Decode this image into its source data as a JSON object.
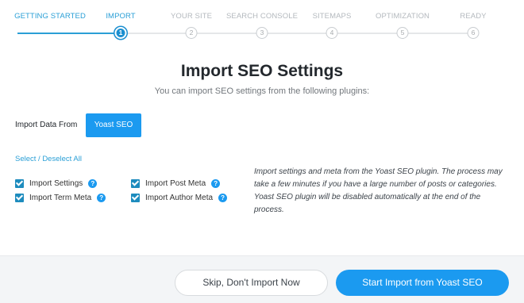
{
  "stepper": {
    "steps": [
      {
        "label": "GETTING STARTED",
        "number": "",
        "state": "done"
      },
      {
        "label": "IMPORT",
        "number": "1",
        "state": "active"
      },
      {
        "label": "YOUR SITE",
        "number": "2",
        "state": "pending"
      },
      {
        "label": "SEARCH CONSOLE",
        "number": "3",
        "state": "pending"
      },
      {
        "label": "SITEMAPS",
        "number": "4",
        "state": "pending"
      },
      {
        "label": "OPTIMIZATION",
        "number": "5",
        "state": "pending"
      },
      {
        "label": "READY",
        "number": "6",
        "state": "pending"
      }
    ]
  },
  "header": {
    "title": "Import SEO Settings",
    "subtitle": "You can import SEO settings from the following plugins:"
  },
  "import_from": {
    "label": "Import Data From",
    "plugin_button": "Yoast SEO"
  },
  "select_all": "Select / Deselect All",
  "options": [
    {
      "label": "Import Settings",
      "checked": true
    },
    {
      "label": "Import Post Meta",
      "checked": true
    },
    {
      "label": "Import Term Meta",
      "checked": true
    },
    {
      "label": "Import Author Meta",
      "checked": true
    }
  ],
  "help_glyph": "?",
  "description": "Import settings and meta from the Yoast SEO plugin. The process may take a few minutes if you have a large number of posts or categories. Yoast SEO plugin will be disabled automatically at the end of the process.",
  "footer": {
    "skip_label": "Skip, Don't Import Now",
    "start_label": "Start Import from Yoast SEO"
  },
  "colors": {
    "accent": "#1b9af0",
    "step_active": "#2a9fd6",
    "inactive": "#b4b9be",
    "footer_bg": "#f3f5f7"
  },
  "icons": [
    "check-icon",
    "help-icon"
  ]
}
